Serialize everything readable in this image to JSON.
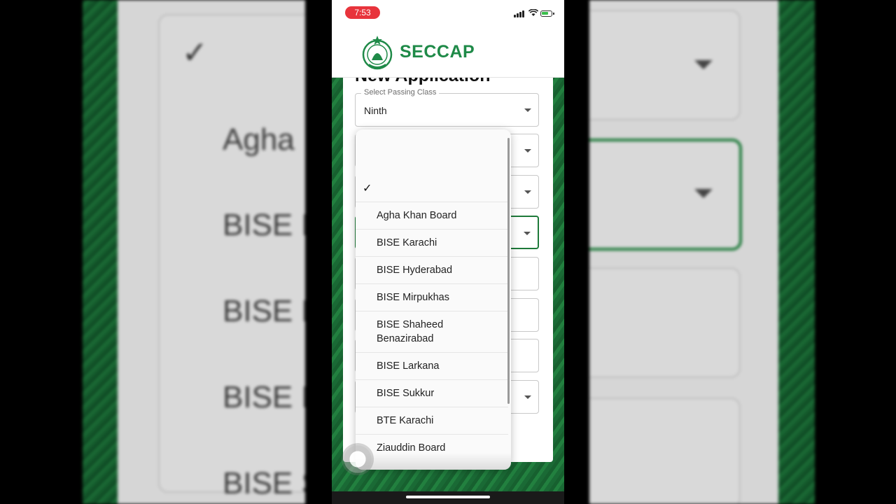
{
  "status_bar": {
    "time": "7:53"
  },
  "app": {
    "brand": "SECCAP"
  },
  "form": {
    "title": "New Application",
    "passing_class": {
      "label": "Select Passing Class",
      "value": "Ninth"
    }
  },
  "board_dropdown": {
    "selected_index": 0,
    "options": [
      "",
      "Agha Khan Board",
      "BISE Karachi",
      "BISE Hyderabad",
      "BISE Mirpukhas",
      "BISE Shaheed Benazirabad",
      "BISE Larkana",
      "BISE Sukkur",
      "BTE Karachi",
      "Ziauddin Board"
    ],
    "check_glyph": "✓"
  },
  "background_zoom": {
    "lines": [
      "Agha",
      "BISE K",
      "BISE K",
      "BISE M",
      "BISE S"
    ]
  },
  "colors": {
    "brand_green": "#1f8a48",
    "status_time_pill": "#e8343c"
  }
}
